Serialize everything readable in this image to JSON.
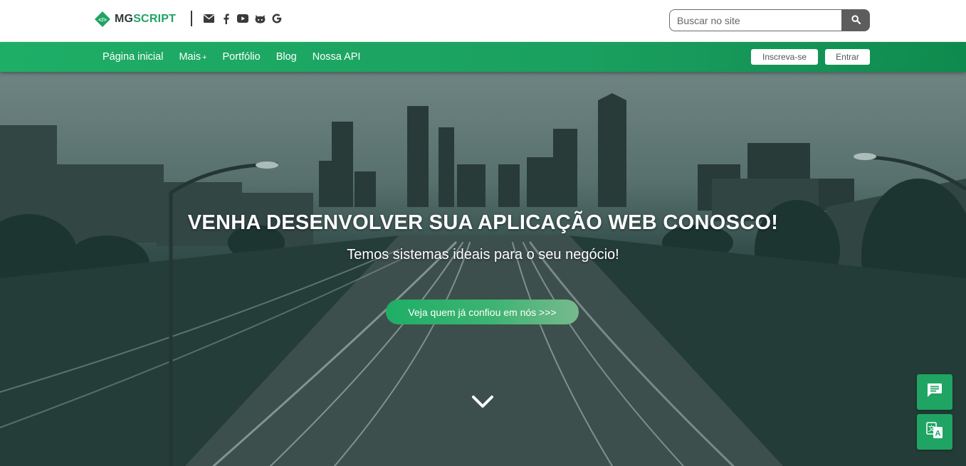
{
  "brand": {
    "name_part1": "MG",
    "name_part2": "SCRIPT",
    "primary_color": "#1fa463",
    "dark_color": "#2d3b3a"
  },
  "social_icons": [
    "envelope-icon",
    "facebook-icon",
    "youtube-icon",
    "github-icon",
    "google-icon"
  ],
  "search": {
    "placeholder": "Buscar no site",
    "value": ""
  },
  "nav": {
    "items": [
      {
        "label": "Página inicial"
      },
      {
        "label": "Mais",
        "suffix": "+"
      },
      {
        "label": "Portfólio"
      },
      {
        "label": "Blog"
      },
      {
        "label": "Nossa API"
      }
    ],
    "signup_label": "Inscreva-se",
    "login_label": "Entrar"
  },
  "hero": {
    "title": "VENHA DESENVOLVER SUA APLICAÇÃO WEB CONOSCO!",
    "subtitle": "Temos sistemas ideais para o seu negócio!",
    "cta_label": "Veja quem já confiou em nós >>>"
  },
  "floating": {
    "chat_icon": "chat-icon",
    "translate_icon": "translate-icon"
  }
}
